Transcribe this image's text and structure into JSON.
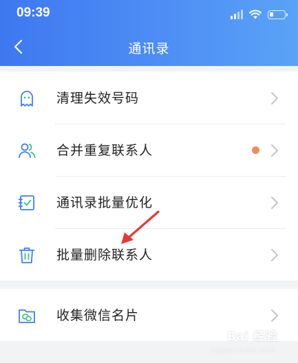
{
  "status_bar": {
    "time": "09:39",
    "icons": [
      "signal-icon",
      "wifi-icon",
      "battery-icon"
    ]
  },
  "nav": {
    "title": "通讯录",
    "back_icon": "chevron-left-icon"
  },
  "menu": {
    "items": [
      {
        "label": "清理失效号码",
        "icon": "ghost-icon",
        "has_badge": false
      },
      {
        "label": "合并重复联系人",
        "icon": "users-icon",
        "has_badge": true
      },
      {
        "label": "通讯录批量优化",
        "icon": "checklist-icon",
        "has_badge": false
      },
      {
        "label": "批量删除联系人",
        "icon": "trash-icon",
        "has_badge": false
      }
    ],
    "secondary": [
      {
        "label": "收集微信名片",
        "icon": "wechat-folder-icon",
        "has_badge": false
      }
    ]
  },
  "colors": {
    "header_start": "#3e78f0",
    "header_end": "#5aa3f7",
    "icon_blue": "#3b7ff0",
    "icon_green": "#3fbe7a",
    "badge": "#f08a5d",
    "annotation_arrow": "#e53935"
  },
  "watermark": {
    "text": "Bai 经验",
    "sub": "jingyan.baidu.com"
  }
}
